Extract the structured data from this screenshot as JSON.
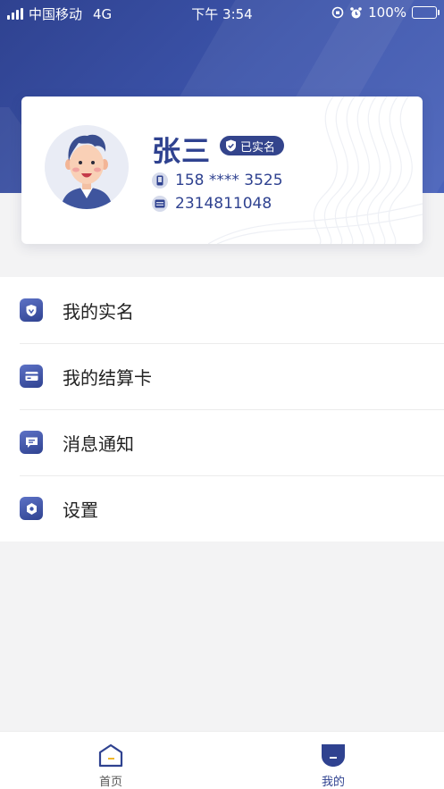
{
  "status_bar": {
    "carrier": "中国移动",
    "network": "4G",
    "time": "下午 3:54",
    "battery": "100%"
  },
  "profile": {
    "name": "张三",
    "verified_badge": "已实名",
    "phone": "158 **** 3525",
    "id_number": "2314811048"
  },
  "menu": {
    "items": [
      {
        "label": "我的实名",
        "icon": "shield-check-icon"
      },
      {
        "label": "我的结算卡",
        "icon": "card-icon"
      },
      {
        "label": "消息通知",
        "icon": "message-icon"
      },
      {
        "label": "设置",
        "icon": "gear-icon"
      }
    ]
  },
  "tab_bar": {
    "home_label": "首页",
    "mine_label": "我的",
    "active": "mine"
  },
  "colors": {
    "brand": "#2f4290",
    "brand_light": "#4a63bb",
    "background": "#f3f3f4"
  }
}
